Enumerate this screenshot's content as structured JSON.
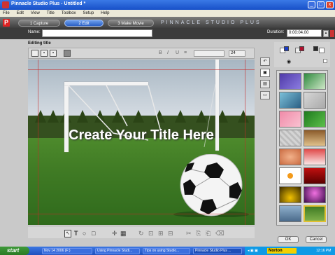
{
  "window": {
    "title": "Pinnacle Studio Plus - Untitled *"
  },
  "menu": [
    "File",
    "Edit",
    "View",
    "Title",
    "Toolbox",
    "Setup",
    "Help"
  ],
  "tabs": {
    "capture": "1 Capture",
    "edit": "2 Edit",
    "make_movie": "3 Make Movie",
    "brand": "PINNACLE STUDIO PLUS"
  },
  "name_bar": {
    "name_label": "Name:",
    "name_value": "",
    "duration_label": "Duration:",
    "duration_value": "0:00:04.00"
  },
  "editor": {
    "heading": "Editing title",
    "title_text": "Create Your Title Here",
    "font_size_value": "24"
  },
  "gallery": {
    "ok_label": "OK",
    "cancel_label": "Cancel",
    "swatches": [
      "#1a3cc8",
      "#b0102e",
      "#2a2a2a"
    ]
  },
  "taskbar": {
    "start_label": "start",
    "tasks": [
      "Nov 14 2006 (F:)",
      "Using Pinnacle Studi...",
      "Tips on using Studio...",
      "Pinnacle Studio Plus ..."
    ],
    "norton_label": "Norton",
    "clock": "12:16 PM"
  }
}
